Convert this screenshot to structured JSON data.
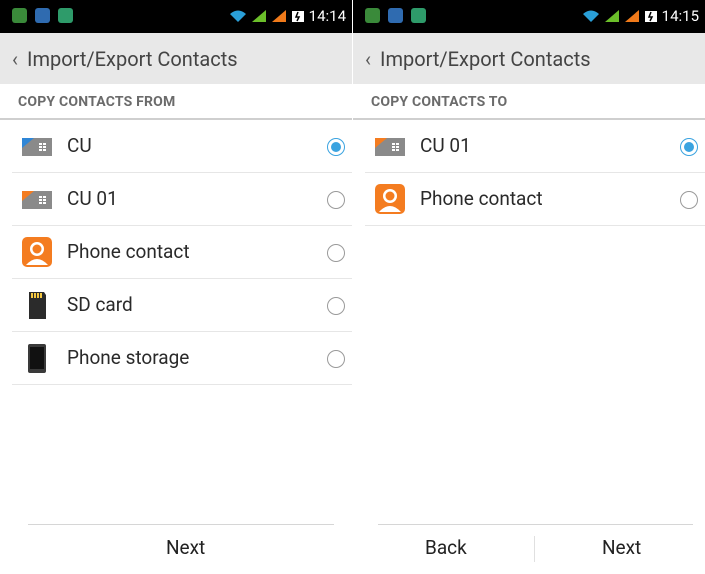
{
  "left": {
    "status": {
      "time": "14:14"
    },
    "header": {
      "back": "‹",
      "title": "Import/Export Contacts"
    },
    "section": "COPY CONTACTS FROM",
    "items": [
      {
        "label": "CU",
        "icon": "sim-card-icon",
        "selected": true
      },
      {
        "label": "CU 01",
        "icon": "sim-card-icon",
        "selected": false
      },
      {
        "label": "Phone contact",
        "icon": "person-icon",
        "selected": false
      },
      {
        "label": "SD card",
        "icon": "sd-card-icon",
        "selected": false
      },
      {
        "label": "Phone storage",
        "icon": "phone-icon",
        "selected": false
      }
    ],
    "buttons": {
      "next": "Next"
    }
  },
  "right": {
    "status": {
      "time": "14:15"
    },
    "header": {
      "back": "‹",
      "title": "Import/Export Contacts"
    },
    "section": "COPY CONTACTS TO",
    "items": [
      {
        "label": "CU 01",
        "icon": "sim-card-icon",
        "selected": true
      },
      {
        "label": "Phone contact",
        "icon": "person-icon",
        "selected": false
      }
    ],
    "buttons": {
      "back": "Back",
      "next": "Next"
    }
  },
  "colors": {
    "accent": "#3aa3e0",
    "orange": "#f47c20"
  }
}
